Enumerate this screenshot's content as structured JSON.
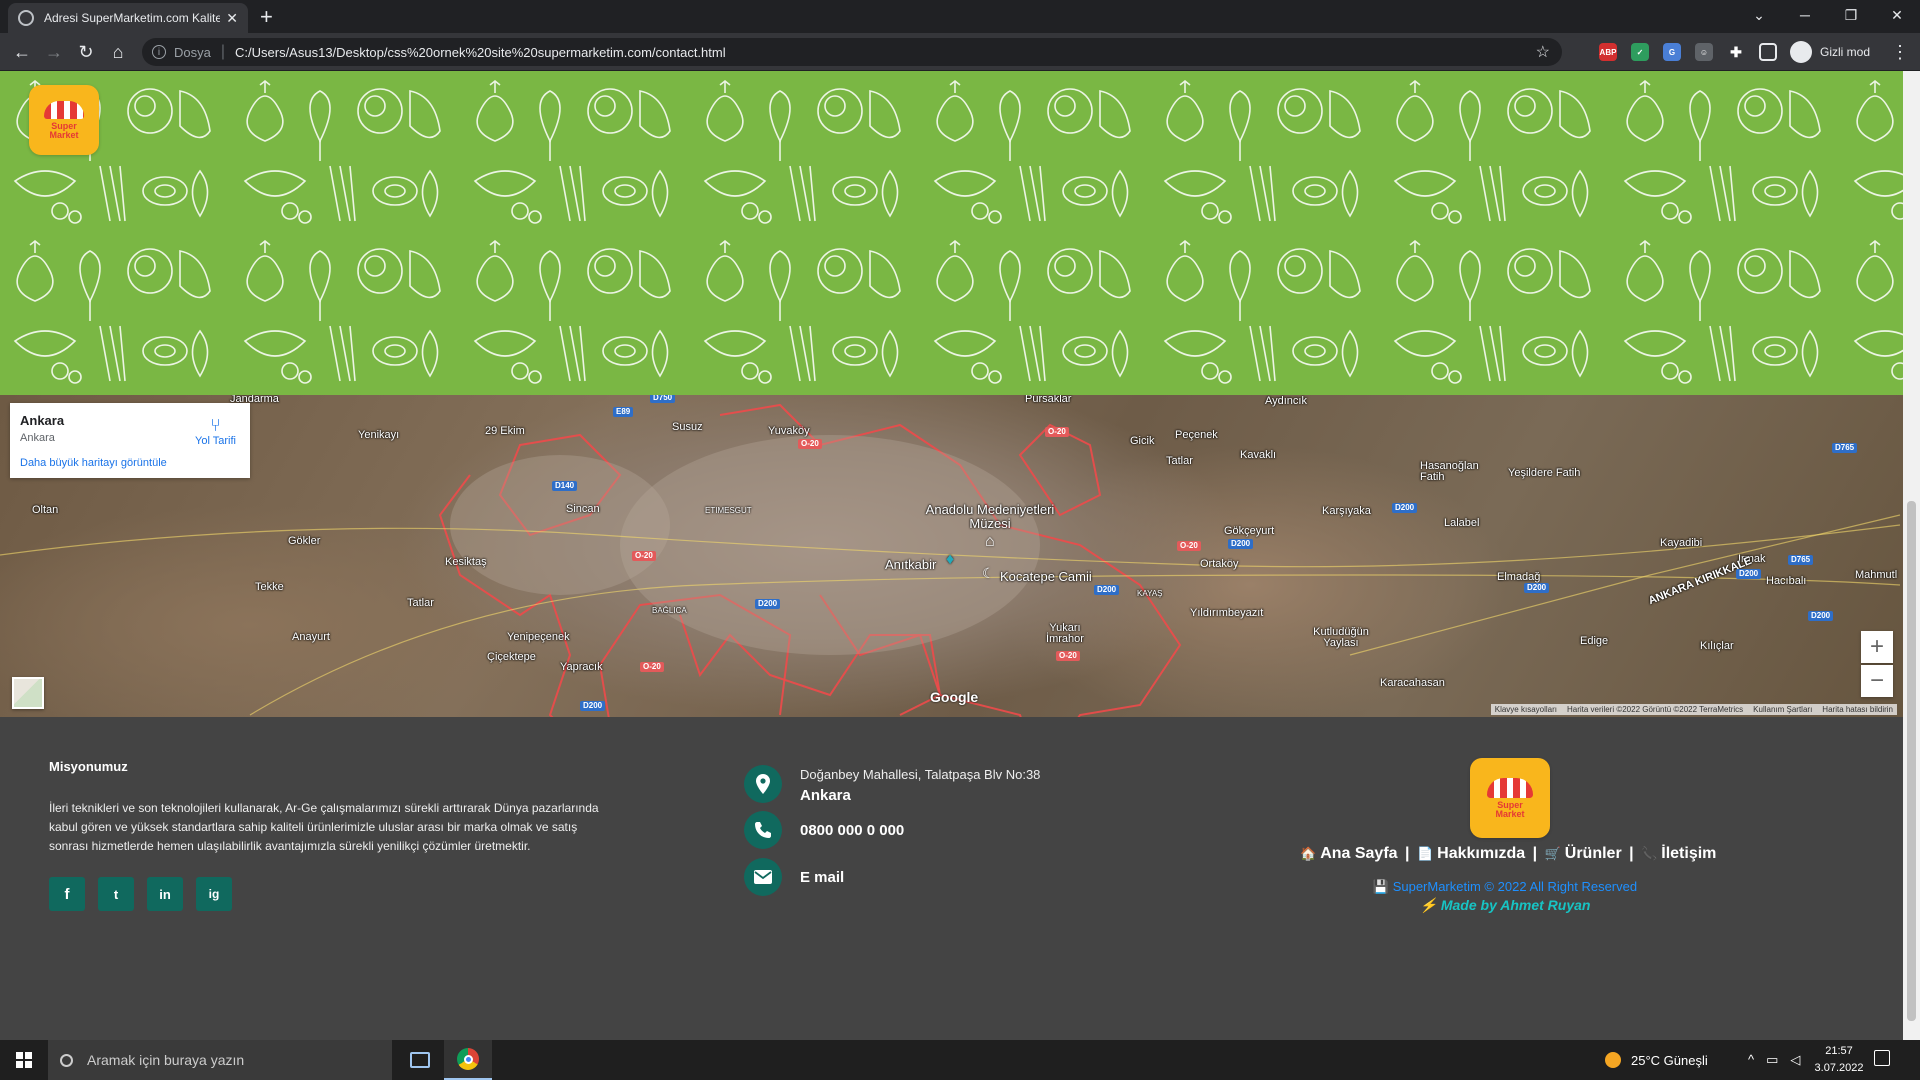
{
  "browser": {
    "tab_title": "Adresi SuperMarketim.com Kalite",
    "tab_close": "✕",
    "new_tab": "+",
    "scheme": "Dosya",
    "url": "C:/Users/Asus13/Desktop/css%20ornek%20site%20supermarketim.com/contact.html",
    "profile_label": "Gizli mod",
    "extensions": [
      "ABP",
      "shield",
      "translate",
      "person",
      "puzzle"
    ]
  },
  "logo": {
    "line1": "Super",
    "line2": "Market"
  },
  "map": {
    "card": {
      "place": "Ankara",
      "sub": "Ankara",
      "directions": "Yol Tarifi",
      "bigger_map": "Daha büyük haritayı görüntüle"
    },
    "labels": {
      "jandarma": "Jandarma",
      "pursaklar": "Pursaklar",
      "aydincik": "Aydıncık",
      "yenikayi": "Yenikayı",
      "ekim29": "29 Ekim",
      "susuz": "Susuz",
      "yuvakoy": "Yuvaköy",
      "gicik": "Gicik",
      "pecenek": "Peçenek",
      "tatlar1": "Tatlar",
      "kavakli": "Kavaklı",
      "hasanoglan": "Hasanoğlan Fatih",
      "yesildere": "Yeşildere Fatih",
      "oltan": "Oltan",
      "sincan": "Sincan",
      "etimesgut": "ETIMESGUT",
      "anadolu": "Anadolu Medeniyetleri Müzesi",
      "gokceyurt": "Gökçeyurt",
      "karsiyaka": "Karşıyaka",
      "lalabel": "Lalabel",
      "kayadibi": "Kayadibi",
      "gokler": "Gökler",
      "kesiktas": "Kesiktaş",
      "anitkabir": "Anıtkabir",
      "kocatepe": "Kocatepe Camii",
      "ortakoy": "Ortaköy",
      "elmadag": "Elmadağ",
      "irmak": "Irmak",
      "hacibali": "Hacıbalı",
      "mahmutli": "Mahmutl",
      "tekke": "Tekke",
      "tatlar2": "Tatlar",
      "baglica": "BAĞLICA",
      "kayas": "KAYAŞ",
      "yildirim": "Yıldırımbeyazıt",
      "kutludugun": "Kutludüğün Yaylası",
      "ankara_kirikkale": "ANKARA KIRIKKALE",
      "anayurt": "Anayurt",
      "yenipecenek": "Yenipeçenek",
      "cicektepe": "Çiçektepe",
      "yukari_imrahor": "Yukarı İmrahor",
      "edige": "Edige",
      "kiliclar": "Kılıçlar",
      "yapracik": "Yapracık",
      "karacahasan": "Karacahasan",
      "google": "Google"
    },
    "roads": [
      "D750",
      "E89",
      "O-20",
      "D140",
      "D200",
      "D765"
    ],
    "zoom_in": "+",
    "zoom_out": "−",
    "attribution": [
      "Klavye kısayolları",
      "Harita verileri ©2022 Görüntü ©2022 TerraMetrics",
      "Kullanım Şartları",
      "Harita hatası bildirin"
    ]
  },
  "footer": {
    "mission_title": "Misyonumuz",
    "mission_text": "İleri teknikleri ve son teknolojileri kullanarak, Ar-Ge çalışmalarımızı sürekli arttırarak Dünya pazarlarında kabul gören ve yüksek standartlara sahip kaliteli ürünlerimizle uluslar arası bir marka olmak ve satış sonrası hizmetlerde hemen ulaşılabilirlik avantajımızla sürekli yenilikçi çözümler üretmektir.",
    "social": [
      "f",
      "t",
      "in",
      "ig"
    ],
    "address_line1": "Doğanbey Mahallesi, Talatpaşa Blv No:38",
    "address_line2": "Ankara",
    "phone": "0800 000 0 000",
    "email": "E mail",
    "nav": [
      "Ana Sayfa",
      "Hakkımızda",
      "Ürünler",
      "İletişim"
    ],
    "nav_separator": "|",
    "copyright": "SuperMarketim © 2022 All Right Reserved",
    "made_by": "Made by Ahmet Ruyan"
  },
  "taskbar": {
    "search_placeholder": "Aramak için buraya yazın",
    "weather": "25°C  Güneşli",
    "time": "21:57",
    "date": "3.07.2022"
  },
  "colors": {
    "hero_green": "#7ab744",
    "footer_bg": "#444444",
    "accent_teal": "#10695e",
    "logo_yellow": "#f9b61c",
    "copyright_blue": "#1e90ff",
    "made_by_cyan": "#17c4c4"
  }
}
